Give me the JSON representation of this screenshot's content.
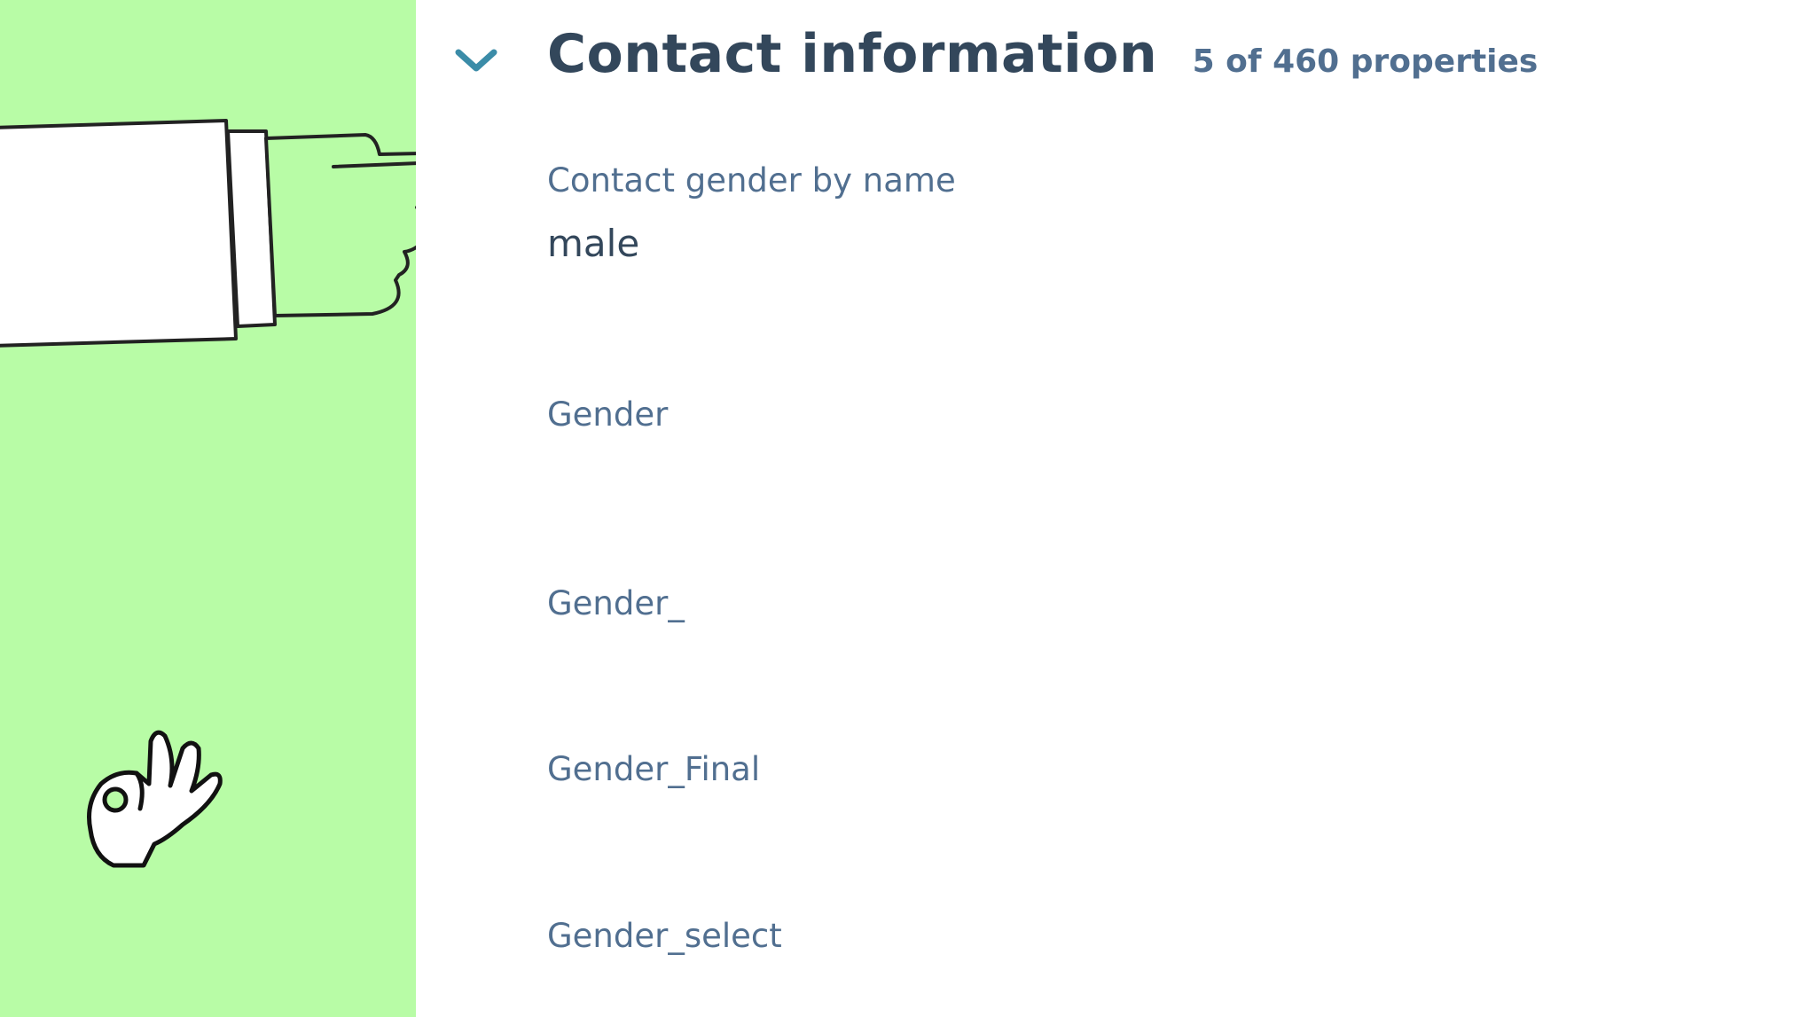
{
  "section": {
    "title": "Contact information",
    "count": "5 of 460 properties",
    "toggle_icon": "chevron-down-icon",
    "accent_color": "#3b8ca8"
  },
  "properties": [
    {
      "label": "Contact gender by name",
      "value": "male"
    },
    {
      "label": "Gender",
      "value": ""
    },
    {
      "label": "Gender_",
      "value": ""
    },
    {
      "label": "Gender_Final",
      "value": ""
    },
    {
      "label": "Gender_select",
      "value": ""
    }
  ],
  "decorations": {
    "side_panel_color": "#b8fca6",
    "illustrations": [
      "pointing-hand-illustration",
      "ok-hand-illustration"
    ]
  }
}
